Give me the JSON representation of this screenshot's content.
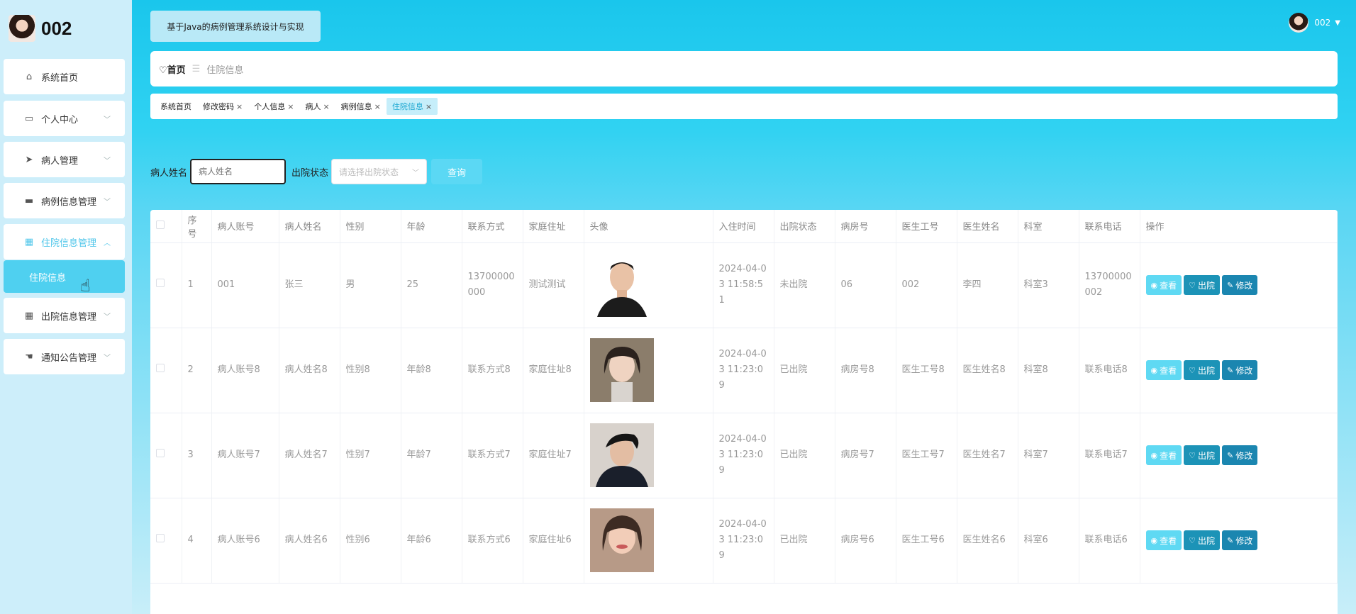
{
  "brand": {
    "name": "002"
  },
  "sidebar": {
    "items": [
      {
        "label": "系统首页",
        "icon": "home-icon"
      },
      {
        "label": "个人中心",
        "icon": "card-icon"
      },
      {
        "label": "病人管理",
        "icon": "send-icon"
      },
      {
        "label": "病例信息管理",
        "icon": "message-icon"
      },
      {
        "label": "住院信息管理",
        "icon": "grid-icon",
        "active": true
      },
      {
        "label": "出院信息管理",
        "icon": "grid-icon"
      },
      {
        "label": "通知公告管理",
        "icon": "thumb-icon"
      }
    ],
    "submenu": {
      "label": "住院信息"
    }
  },
  "header": {
    "title": "基于Java的病例管理系统设计与实现",
    "user": "002"
  },
  "breadcrumb": {
    "home": "首页",
    "current": "住院信息"
  },
  "tags": [
    {
      "label": "系统首页",
      "closable": false
    },
    {
      "label": "修改密码",
      "closable": true
    },
    {
      "label": "个人信息",
      "closable": true
    },
    {
      "label": "病人",
      "closable": true
    },
    {
      "label": "病例信息",
      "closable": true
    },
    {
      "label": "住院信息",
      "closable": true,
      "active": true
    }
  ],
  "search": {
    "name_label": "病人姓名",
    "name_placeholder": "病人姓名",
    "status_label": "出院状态",
    "status_placeholder": "请选择出院状态",
    "button": "查询"
  },
  "table": {
    "headers": [
      "序号",
      "病人账号",
      "病人姓名",
      "性别",
      "年龄",
      "联系方式",
      "家庭住址",
      "头像",
      "入住时间",
      "出院状态",
      "病房号",
      "医生工号",
      "医生姓名",
      "科室",
      "联系电话",
      "操作"
    ],
    "rows": [
      {
        "no": "1",
        "account": "001",
        "name": "张三",
        "gender": "男",
        "age": "25",
        "contact": "13700000000",
        "address": "测试测试",
        "checkin": "2024-04-03 11:58:51",
        "status": "未出院",
        "ward": "06",
        "doctor_no": "002",
        "doctor_name": "李四",
        "dept": "科室3",
        "phone": "13700000002"
      },
      {
        "no": "2",
        "account": "病人账号8",
        "name": "病人姓名8",
        "gender": "性别8",
        "age": "年龄8",
        "contact": "联系方式8",
        "address": "家庭住址8",
        "checkin": "2024-04-03 11:23:09",
        "status": "已出院",
        "ward": "病房号8",
        "doctor_no": "医生工号8",
        "doctor_name": "医生姓名8",
        "dept": "科室8",
        "phone": "联系电话8"
      },
      {
        "no": "3",
        "account": "病人账号7",
        "name": "病人姓名7",
        "gender": "性别7",
        "age": "年龄7",
        "contact": "联系方式7",
        "address": "家庭住址7",
        "checkin": "2024-04-03 11:23:09",
        "status": "已出院",
        "ward": "病房号7",
        "doctor_no": "医生工号7",
        "doctor_name": "医生姓名7",
        "dept": "科室7",
        "phone": "联系电话7"
      },
      {
        "no": "4",
        "account": "病人账号6",
        "name": "病人姓名6",
        "gender": "性别6",
        "age": "年龄6",
        "contact": "联系方式6",
        "address": "家庭住址6",
        "checkin": "2024-04-03 11:23:09",
        "status": "已出院",
        "ward": "病房号6",
        "doctor_no": "医生工号6",
        "doctor_name": "医生姓名6",
        "dept": "科室6",
        "phone": "联系电话6"
      }
    ],
    "actions": {
      "view": "查看",
      "discharge": "出院",
      "edit": "修改"
    }
  },
  "colors": {
    "accent": "#4fc6ea",
    "header_bg": "#1ac6ec",
    "discharge_btn": "#1c93b7",
    "edit_btn": "#1b86b0",
    "view_btn": "#5fd9f3"
  }
}
